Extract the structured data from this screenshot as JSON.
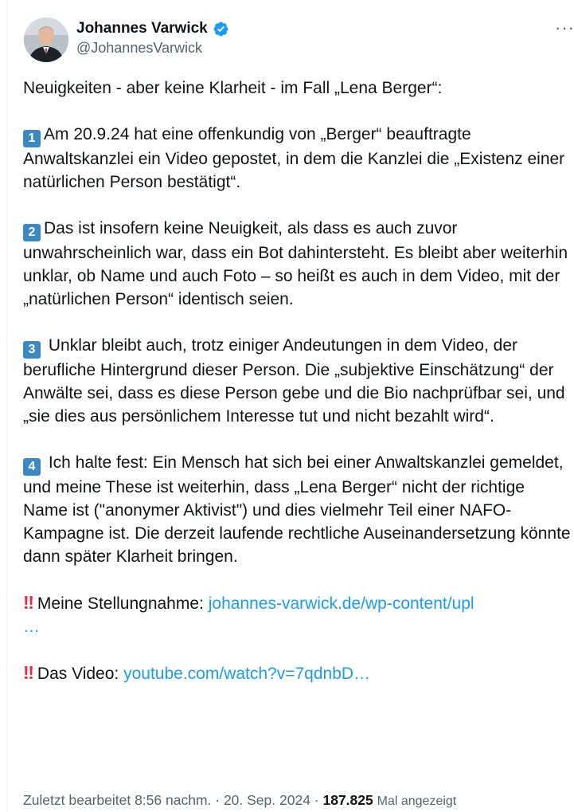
{
  "author": {
    "display_name": "Johannes Varwick",
    "handle": "@JohannesVarwick"
  },
  "more_glyph": "···",
  "tweet": {
    "intro": "Neuigkeiten - aber keine Klarheit - im Fall „Lena Berger“:",
    "points": [
      {
        "num": "1",
        "text": "Am 20.9.24 hat eine offenkundig von „Berger“ beauftragte Anwaltskanzlei ein Video gepostet, in dem die Kanzlei die „Existenz einer natürlichen Person bestätigt“."
      },
      {
        "num": "2",
        "text": "Das ist insofern keine Neuigkeit, als dass es auch zuvor unwahrscheinlich war, dass ein Bot dahintersteht. Es bleibt aber weiterhin unklar, ob Name und auch Foto  – so heißt es auch in dem Video, mit der „natürlichen Person“ identisch seien."
      },
      {
        "num": "3",
        "text": "Unklar bleibt auch, trotz einiger Andeutungen in dem Video, der berufliche Hintergrund dieser Person. Die „subjektive Einschätzung“ der Anwälte sei, dass es diese Person gebe und die Bio nachprüfbar sei, und „sie dies aus persönlichem Interesse tut und nicht bezahlt wird“."
      },
      {
        "num": "4",
        "text": "Ich halte fest: Ein Mensch hat sich bei einer Anwaltskanzlei gemeldet, und meine These ist weiterhin, dass „Lena Berger“ nicht der richtige Name ist (\"anonymer Aktivist\") und dies vielmehr Teil einer NAFO-Kampagne ist. Die derzeit laufende rechtliche Auseinandersetzung könnte dann später Klarheit bringen."
      }
    ],
    "statement": {
      "bang": "‼",
      "label": "Meine Stellungnahme:",
      "link": "johannes-varwick.de/wp-content/upl",
      "ellipsis": "…"
    },
    "video": {
      "bang": "‼",
      "label": "Das Video:",
      "link": "youtube.com/watch?v=7qdnbD…"
    }
  },
  "meta": {
    "edited": "Zuletzt bearbeitet 8:56 nachm. · 20. Sep. 2024 · ",
    "views": "187.825",
    "views_label": "Mal angezeigt"
  },
  "colors": {
    "link": "#1d9bf0",
    "verified": "#1d9bf0",
    "secondary_text": "#536471",
    "keycap": "#3b88c3",
    "bang": "#dd2e44"
  }
}
